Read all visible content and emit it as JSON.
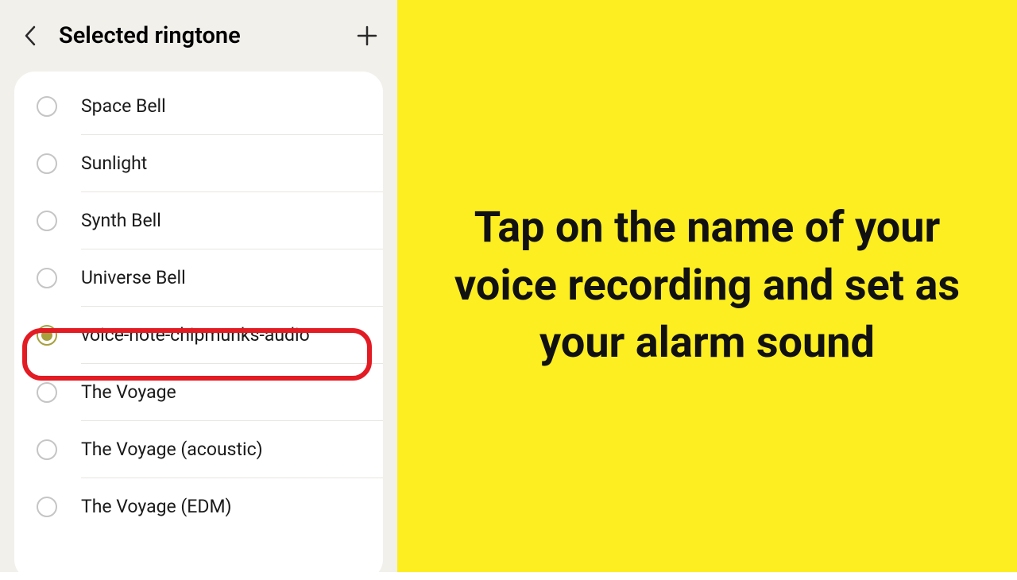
{
  "header": {
    "title": "Selected ringtone"
  },
  "ringtones": [
    {
      "label": "Space Bell",
      "selected": false
    },
    {
      "label": "Sunlight",
      "selected": false
    },
    {
      "label": "Synth Bell",
      "selected": false
    },
    {
      "label": "Universe Bell",
      "selected": false
    },
    {
      "label": "voice-note-chipmunks-audio",
      "selected": true
    },
    {
      "label": "The Voyage",
      "selected": false
    },
    {
      "label": "The Voyage (acoustic)",
      "selected": false
    },
    {
      "label": "The Voyage (EDM)",
      "selected": false
    }
  ],
  "instruction": "Tap on the name of your voice recording and set as your alarm sound"
}
